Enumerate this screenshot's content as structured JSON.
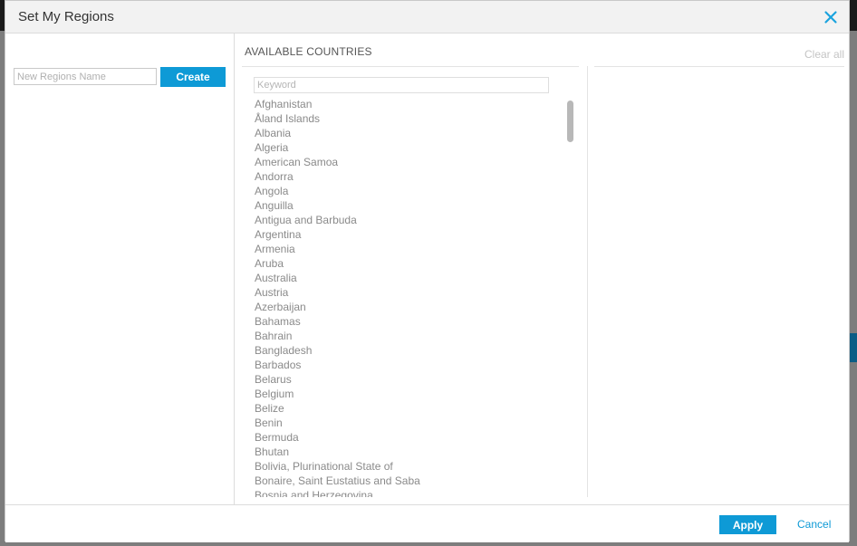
{
  "dialog": {
    "title": "Set My Regions",
    "close_icon": "close-icon",
    "accent_color": "#0e9ad6"
  },
  "left_pane": {
    "name_placeholder": "New Regions Name",
    "create_label": "Create"
  },
  "available": {
    "section_title": "AVAILABLE COUNTRIES",
    "keyword_placeholder": "Keyword",
    "countries": [
      "Afghanistan",
      "Åland Islands",
      "Albania",
      "Algeria",
      "American Samoa",
      "Andorra",
      "Angola",
      "Anguilla",
      "Antigua and Barbuda",
      "Argentina",
      "Armenia",
      "Aruba",
      "Australia",
      "Austria",
      "Azerbaijan",
      "Bahamas",
      "Bahrain",
      "Bangladesh",
      "Barbados",
      "Belarus",
      "Belgium",
      "Belize",
      "Benin",
      "Bermuda",
      "Bhutan",
      "Bolivia, Plurinational State of",
      "Bonaire, Saint Eustatius and Saba",
      "Bosnia and Herzegovina"
    ]
  },
  "selected": {
    "clear_all_label": "Clear all"
  },
  "footer": {
    "apply_label": "Apply",
    "cancel_label": "Cancel"
  }
}
